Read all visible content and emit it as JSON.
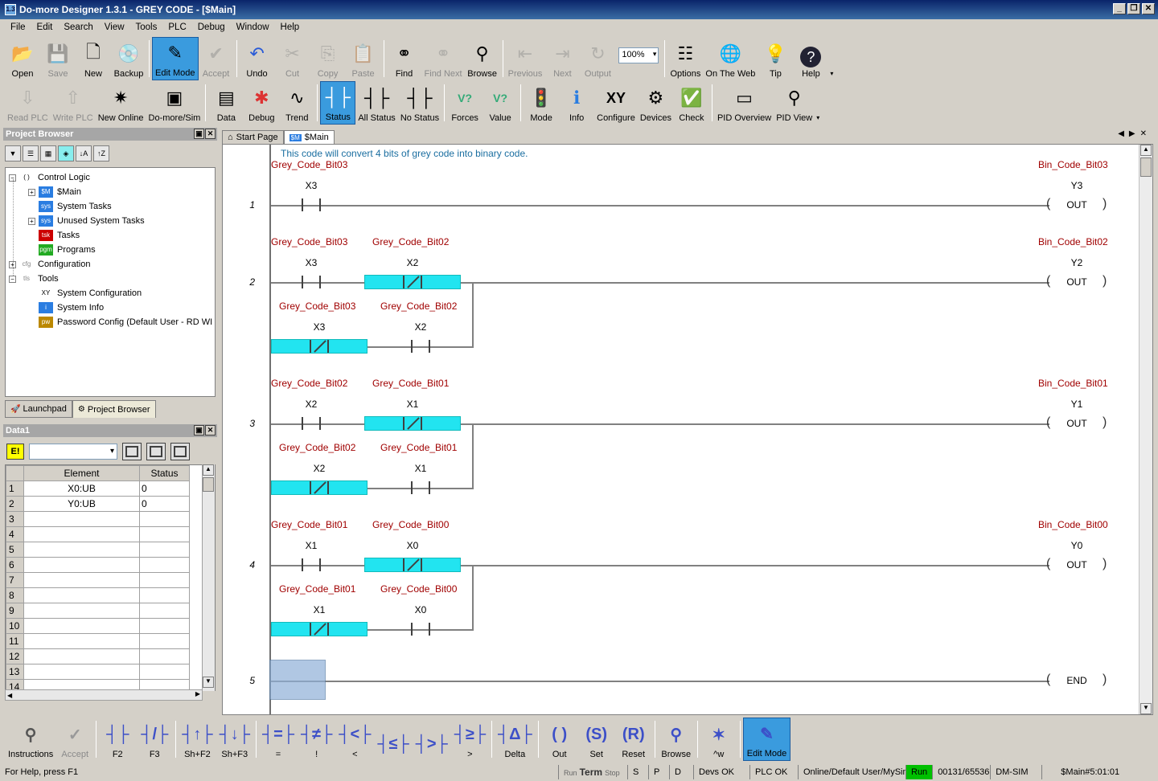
{
  "window": {
    "title": "Do-more Designer 1.3.1 - GREY CODE - [$Main]",
    "app_icon": "1.3"
  },
  "menu": [
    "File",
    "Edit",
    "Search",
    "View",
    "Tools",
    "PLC",
    "Debug",
    "Window",
    "Help"
  ],
  "toolbar1": [
    {
      "label": "Open",
      "icon": "open-folder-icon",
      "disabled": false
    },
    {
      "label": "Save",
      "icon": "floppy-icon",
      "disabled": true
    },
    {
      "label": "New",
      "icon": "new-doc-icon",
      "disabled": false
    },
    {
      "label": "Backup",
      "icon": "backup-disc-icon",
      "disabled": false
    },
    {
      "label": "Edit Mode",
      "icon": "edit-pencil-icon",
      "disabled": false,
      "active": true
    },
    {
      "label": "Accept",
      "icon": "accept-icon",
      "disabled": true
    },
    {
      "label": "Undo",
      "icon": "undo-icon",
      "disabled": false
    },
    {
      "label": "Cut",
      "icon": "scissors-icon",
      "disabled": true
    },
    {
      "label": "Copy",
      "icon": "copy-icon",
      "disabled": true
    },
    {
      "label": "Paste",
      "icon": "paste-icon",
      "disabled": true
    },
    {
      "label": "Find",
      "icon": "binoculars-icon",
      "disabled": false
    },
    {
      "label": "Find Next",
      "icon": "binoculars-icon",
      "disabled": true
    },
    {
      "label": "Browse",
      "icon": "magnifier-icon",
      "disabled": false
    },
    {
      "label": "Previous",
      "icon": "previous-icon",
      "disabled": true
    },
    {
      "label": "Next",
      "icon": "next-icon",
      "disabled": true
    },
    {
      "label": "Output",
      "icon": "output-icon",
      "disabled": true
    },
    {
      "label": "Options",
      "icon": "options-icon",
      "disabled": false
    },
    {
      "label": "On The Web",
      "icon": "globe-icon",
      "disabled": false
    },
    {
      "label": "Tip",
      "icon": "lightbulb-icon",
      "disabled": false
    },
    {
      "label": "Help",
      "icon": "help-icon",
      "disabled": false
    }
  ],
  "zoom": "100%",
  "toolbar2": [
    {
      "label": "Read PLC",
      "icon": "read-plc-icon",
      "disabled": true
    },
    {
      "label": "Write PLC",
      "icon": "write-plc-icon",
      "disabled": true
    },
    {
      "label": "New Online",
      "icon": "new-online-icon",
      "disabled": false
    },
    {
      "label": "Do-more/Sim",
      "icon": "sim-icon",
      "disabled": false
    },
    {
      "label": "Data",
      "icon": "data-icon",
      "disabled": false
    },
    {
      "label": "Debug",
      "icon": "debug-icon",
      "disabled": false
    },
    {
      "label": "Trend",
      "icon": "trend-icon",
      "disabled": false
    },
    {
      "label": "Status",
      "icon": "status-icon",
      "disabled": false,
      "active": true
    },
    {
      "label": "All Status",
      "icon": "all-status-icon",
      "disabled": false
    },
    {
      "label": "No Status",
      "icon": "no-status-icon",
      "disabled": false
    },
    {
      "label": "Forces",
      "icon": "forces-icon",
      "disabled": false
    },
    {
      "label": "Value",
      "icon": "value-icon",
      "disabled": false
    },
    {
      "label": "Mode",
      "icon": "traffic-light-icon",
      "disabled": false
    },
    {
      "label": "Info",
      "icon": "info-icon",
      "disabled": false
    },
    {
      "label": "Configure",
      "icon": "xy-configure-icon",
      "disabled": false
    },
    {
      "label": "Devices",
      "icon": "devices-icon",
      "disabled": false
    },
    {
      "label": "Check",
      "icon": "check-icon",
      "disabled": false
    },
    {
      "label": "PID Overview",
      "icon": "pid-overview-icon",
      "disabled": false
    },
    {
      "label": "PID View",
      "icon": "pid-view-icon",
      "disabled": false
    }
  ],
  "project_browser": {
    "title": "Project Browser",
    "tree": [
      {
        "label": "Control Logic",
        "level": 0,
        "exp": "−",
        "icon": "( )"
      },
      {
        "label": "$Main",
        "level": 1,
        "exp": "+",
        "icon": "$M"
      },
      {
        "label": "System Tasks",
        "level": 1,
        "exp": "",
        "icon": "sys"
      },
      {
        "label": "Unused System Tasks",
        "level": 1,
        "exp": "+",
        "icon": "sys"
      },
      {
        "label": "Tasks",
        "level": 1,
        "exp": "",
        "icon": "tsk"
      },
      {
        "label": "Programs",
        "level": 1,
        "exp": "",
        "icon": "pgm"
      },
      {
        "label": "Configuration",
        "level": 0,
        "exp": "+",
        "icon": "cfg"
      },
      {
        "label": "Tools",
        "level": 0,
        "exp": "−",
        "icon": "tls"
      },
      {
        "label": "System Configuration",
        "level": 1,
        "exp": "",
        "icon": "XY"
      },
      {
        "label": "System Info",
        "level": 1,
        "exp": "",
        "icon": "i"
      },
      {
        "label": "Password Config (Default User - RD WI",
        "level": 1,
        "exp": "",
        "icon": "pw"
      }
    ],
    "tabs": [
      "Launchpad",
      "Project Browser"
    ]
  },
  "data_pane": {
    "title": "Data1",
    "e_button": "E!",
    "columns": [
      "Element",
      "Status"
    ],
    "rows": [
      {
        "n": "1",
        "element": "X0:UB",
        "status": "0"
      },
      {
        "n": "2",
        "element": "Y0:UB",
        "status": "0"
      },
      {
        "n": "3",
        "element": "",
        "status": ""
      },
      {
        "n": "4",
        "element": "",
        "status": ""
      },
      {
        "n": "5",
        "element": "",
        "status": ""
      },
      {
        "n": "6",
        "element": "",
        "status": ""
      },
      {
        "n": "7",
        "element": "",
        "status": ""
      },
      {
        "n": "8",
        "element": "",
        "status": ""
      },
      {
        "n": "9",
        "element": "",
        "status": ""
      },
      {
        "n": "10",
        "element": "",
        "status": ""
      },
      {
        "n": "11",
        "element": "",
        "status": ""
      },
      {
        "n": "12",
        "element": "",
        "status": ""
      },
      {
        "n": "13",
        "element": "",
        "status": ""
      },
      {
        "n": "14",
        "element": "",
        "status": ""
      }
    ]
  },
  "doc_tabs": [
    "Start Page",
    "$Main"
  ],
  "ladder": {
    "comment": "This code will convert 4 bits of grey code into binary code.",
    "rungs": [
      {
        "num": "1",
        "top": [
          {
            "label": "Grey_Code_Bit03",
            "addr": "X3",
            "type": "NO"
          }
        ],
        "branch": null,
        "coil": {
          "label": "Bin_Code_Bit03",
          "addr": "Y3",
          "text": "OUT"
        }
      },
      {
        "num": "2",
        "top": [
          {
            "label": "Grey_Code_Bit03",
            "addr": "X3",
            "type": "NO"
          },
          {
            "label": "Grey_Code_Bit02",
            "addr": "X2",
            "type": "NC"
          }
        ],
        "branch": [
          {
            "label": "Grey_Code_Bit03",
            "addr": "X3",
            "type": "NC"
          },
          {
            "label": "Grey_Code_Bit02",
            "addr": "X2",
            "type": "NO"
          }
        ],
        "coil": {
          "label": "Bin_Code_Bit02",
          "addr": "Y2",
          "text": "OUT"
        }
      },
      {
        "num": "3",
        "top": [
          {
            "label": "Grey_Code_Bit02",
            "addr": "X2",
            "type": "NO"
          },
          {
            "label": "Grey_Code_Bit01",
            "addr": "X1",
            "type": "NC"
          }
        ],
        "branch": [
          {
            "label": "Grey_Code_Bit02",
            "addr": "X2",
            "type": "NC"
          },
          {
            "label": "Grey_Code_Bit01",
            "addr": "X1",
            "type": "NO"
          }
        ],
        "coil": {
          "label": "Bin_Code_Bit01",
          "addr": "Y1",
          "text": "OUT"
        }
      },
      {
        "num": "4",
        "top": [
          {
            "label": "Grey_Code_Bit01",
            "addr": "X1",
            "type": "NO"
          },
          {
            "label": "Grey_Code_Bit00",
            "addr": "X0",
            "type": "NC"
          }
        ],
        "branch": [
          {
            "label": "Grey_Code_Bit01",
            "addr": "X1",
            "type": "NC"
          },
          {
            "label": "Grey_Code_Bit00",
            "addr": "X0",
            "type": "NO"
          }
        ],
        "coil": {
          "label": "Bin_Code_Bit00",
          "addr": "Y0",
          "text": "OUT"
        }
      },
      {
        "num": "5",
        "top": [],
        "branch": null,
        "coil": {
          "label": "",
          "addr": "",
          "text": "END"
        }
      }
    ]
  },
  "instruction_bar": [
    {
      "label": "Instructions",
      "glyph": "⚲",
      "icon": "instructions-icon"
    },
    {
      "label": "Accept",
      "glyph": "✓",
      "icon": "accept-icon",
      "disabled": true
    },
    {
      "label": "F2",
      "glyph": "┤├",
      "icon": "no-contact-icon"
    },
    {
      "label": "F3",
      "glyph": "┤/├",
      "icon": "nc-contact-icon"
    },
    {
      "label": "Sh+F2",
      "glyph": "┤↑├",
      "icon": "rising-edge-icon"
    },
    {
      "label": "Sh+F3",
      "glyph": "┤↓├",
      "icon": "falling-edge-icon"
    },
    {
      "label": "=",
      "glyph": "┤=├",
      "icon": "equal-icon"
    },
    {
      "label": "!",
      "glyph": "┤≠├",
      "icon": "not-equal-icon"
    },
    {
      "label": "<",
      "glyph": "┤<├",
      "icon": "less-than-icon"
    },
    {
      "label": "",
      "glyph": "┤≤├",
      "icon": "less-equal-icon"
    },
    {
      "label": "",
      "glyph": "┤>├",
      "icon": "greater-than-icon"
    },
    {
      "label": ">",
      "glyph": "┤≥├",
      "icon": "greater-equal-icon"
    },
    {
      "label": "Delta",
      "glyph": "┤Δ├",
      "icon": "delta-icon"
    },
    {
      "label": "Out",
      "glyph": "( )",
      "icon": "out-coil-icon"
    },
    {
      "label": "Set",
      "glyph": "(S)",
      "icon": "set-coil-icon"
    },
    {
      "label": "Reset",
      "glyph": "(R)",
      "icon": "reset-coil-icon"
    },
    {
      "label": "Browse",
      "glyph": "⚲",
      "icon": "browse-magnifier-icon"
    },
    {
      "label": "^w",
      "glyph": "✶",
      "icon": "wire-tool-icon"
    },
    {
      "label": "Edit Mode",
      "glyph": "✎",
      "icon": "edit-mode-icon",
      "active": true
    }
  ],
  "status_bar": {
    "help": "For Help, press F1",
    "run_term_stop": [
      "Run",
      "Term",
      "Stop"
    ],
    "flags": [
      "S",
      "P",
      "D"
    ],
    "devs": "Devs OK",
    "plc": "PLC OK",
    "conn": "Online/Default User/MySim",
    "run": "Run",
    "mem": "00131/65536",
    "sim": "DM-SIM",
    "pos": "$Main#5:01:01"
  },
  "colors": {
    "highlight": "#22e4f0",
    "label": "#a00000",
    "comment": "#1a6ea0",
    "active_btn": "#3a9bde"
  }
}
